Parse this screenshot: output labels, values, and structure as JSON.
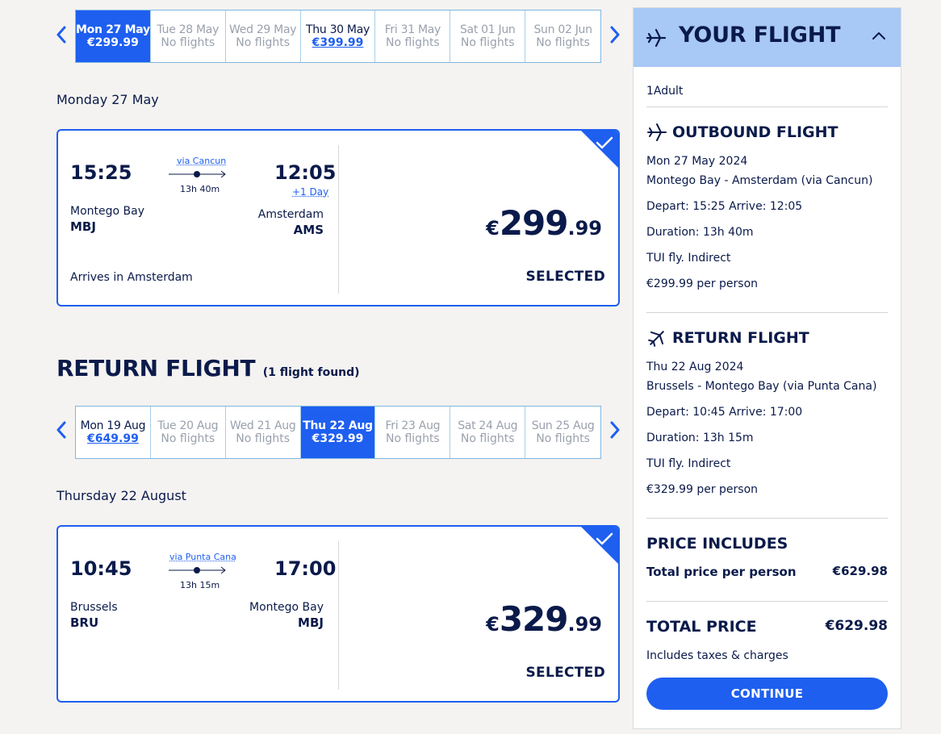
{
  "outbound": {
    "dates": [
      {
        "day": "Mon 27 May",
        "price": "€299.99",
        "state": "active"
      },
      {
        "day": "Tue 28 May",
        "price": "No flights",
        "state": "none"
      },
      {
        "day": "Wed 29 May",
        "price": "No flights",
        "state": "none"
      },
      {
        "day": "Thu 30 May",
        "price": "€399.99",
        "state": "link"
      },
      {
        "day": "Fri 31 May",
        "price": "No flights",
        "state": "none"
      },
      {
        "day": "Sat 01 Jun",
        "price": "No flights",
        "state": "none"
      },
      {
        "day": "Sun 02 Jun",
        "price": "No flights",
        "state": "none"
      }
    ],
    "heading": "Monday 27 May",
    "depart_time": "15:25",
    "via": "via Cancun",
    "duration": "13h 40m",
    "arrive_time": "12:05",
    "plus_day": "+1 Day",
    "origin_city": "Montego Bay",
    "origin_code": "MBJ",
    "dest_city": "Amsterdam",
    "dest_code": "AMS",
    "note": "Arrives in Amsterdam",
    "price_currency": "€",
    "price_whole": "299",
    "price_cents": ".99",
    "status": "SELECTED"
  },
  "return_section": {
    "title": "RETURN FLIGHT",
    "count": "(1 flight found)"
  },
  "return": {
    "dates": [
      {
        "day": "Mon 19 Aug",
        "price": "€649.99",
        "state": "link"
      },
      {
        "day": "Tue 20 Aug",
        "price": "No flights",
        "state": "none"
      },
      {
        "day": "Wed 21 Aug",
        "price": "No flights",
        "state": "none"
      },
      {
        "day": "Thu 22 Aug",
        "price": "€329.99",
        "state": "active"
      },
      {
        "day": "Fri 23 Aug",
        "price": "No flights",
        "state": "none"
      },
      {
        "day": "Sat 24 Aug",
        "price": "No flights",
        "state": "none"
      },
      {
        "day": "Sun 25 Aug",
        "price": "No flights",
        "state": "none"
      }
    ],
    "heading": "Thursday 22 August",
    "depart_time": "10:45",
    "via": "via Punta Cana",
    "duration": "13h 15m",
    "arrive_time": "17:00",
    "origin_city": "Brussels",
    "origin_code": "BRU",
    "dest_city": "Montego Bay",
    "dest_code": "MBJ",
    "price_currency": "€",
    "price_whole": "329",
    "price_cents": ".99",
    "status": "SELECTED"
  },
  "sidebar": {
    "title": "YOUR FLIGHT",
    "passengers": "1Adult",
    "outbound": {
      "heading": "OUTBOUND FLIGHT",
      "date": "Mon 27 May 2024",
      "route": "Montego Bay - Amsterdam (via Cancun)",
      "times": "Depart: 15:25 Arrive: 12:05",
      "duration": "Duration: 13h 40m",
      "carrier": "TUI fly. Indirect",
      "price": "€299.99 per person"
    },
    "return": {
      "heading": "RETURN FLIGHT",
      "date": "Thu 22 Aug 2024",
      "route": "Brussels - Montego Bay (via Punta Cana)",
      "times": "Depart: 10:45 Arrive: 17:00",
      "duration": "Duration: 13h 15m",
      "carrier": "TUI fly. Indirect",
      "price": "€329.99 per person"
    },
    "price_includes": {
      "heading": "PRICE INCLUDES",
      "label": "Total price per person",
      "value": "€629.98"
    },
    "total": {
      "label": "TOTAL PRICE",
      "value": "€629.98",
      "note": "Includes taxes & charges"
    },
    "continue_label": "CONTINUE"
  },
  "colors": {
    "accent": "#1e5ff0",
    "navy": "#0a1a4a",
    "sidebar_header": "#a8c8f5",
    "background": "#f4f3f1"
  }
}
